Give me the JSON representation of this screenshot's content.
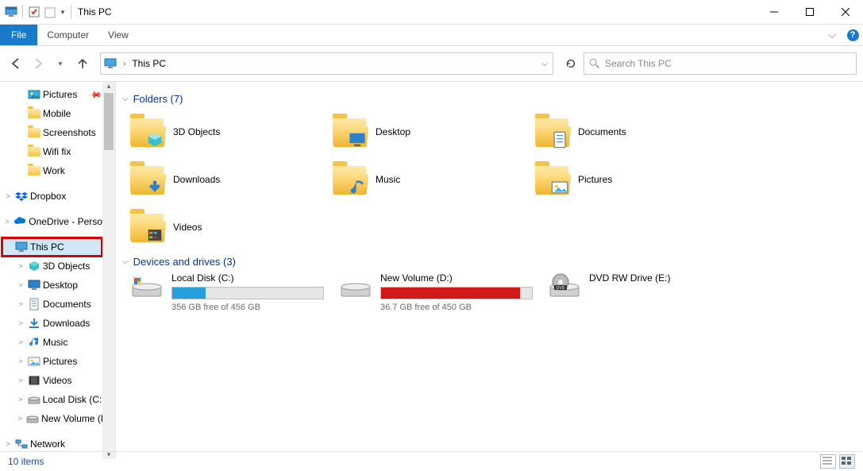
{
  "window": {
    "title": "This PC"
  },
  "ribbon": {
    "file": "File",
    "tabs": [
      "Computer",
      "View"
    ]
  },
  "nav": {
    "breadcrumb_icon": "pc",
    "breadcrumb": "This PC",
    "search_placeholder": "Search This PC"
  },
  "sidebar": {
    "items": [
      {
        "label": "Pictures",
        "icon": "pictures-lib",
        "pinned": true,
        "indent": 1
      },
      {
        "label": "Mobile",
        "icon": "folder",
        "indent": 1
      },
      {
        "label": "Screenshots",
        "icon": "folder",
        "indent": 1
      },
      {
        "label": "Wifi fix",
        "icon": "folder",
        "indent": 1
      },
      {
        "label": "Work",
        "icon": "folder",
        "indent": 1
      },
      {
        "label": "Dropbox",
        "icon": "dropbox",
        "expander": true,
        "indent": 0,
        "gapBefore": true
      },
      {
        "label": "OneDrive - Personal",
        "icon": "onedrive",
        "expander": true,
        "indent": 0,
        "gapBefore": true
      },
      {
        "label": "This PC",
        "icon": "pc",
        "indent": 0,
        "highlight": true,
        "gapBefore": true
      },
      {
        "label": "3D Objects",
        "icon": "3d",
        "expander": true,
        "indent": 1
      },
      {
        "label": "Desktop",
        "icon": "desktop",
        "expander": true,
        "indent": 1
      },
      {
        "label": "Documents",
        "icon": "documents",
        "expander": true,
        "indent": 1
      },
      {
        "label": "Downloads",
        "icon": "downloads",
        "expander": true,
        "indent": 1
      },
      {
        "label": "Music",
        "icon": "music",
        "expander": true,
        "indent": 1
      },
      {
        "label": "Pictures",
        "icon": "pictures",
        "expander": true,
        "indent": 1
      },
      {
        "label": "Videos",
        "icon": "videos",
        "expander": true,
        "indent": 1
      },
      {
        "label": "Local Disk (C:)",
        "icon": "disk",
        "expander": true,
        "indent": 1
      },
      {
        "label": "New Volume (D:)",
        "icon": "disk",
        "expander": true,
        "indent": 1
      },
      {
        "label": "Network",
        "icon": "network",
        "expander": true,
        "indent": 0,
        "gapBefore": true
      }
    ]
  },
  "sections": {
    "folders_title": "Folders (7)",
    "drives_title": "Devices and drives (3)"
  },
  "folders": [
    {
      "label": "3D Objects",
      "overlay": "3d"
    },
    {
      "label": "Desktop",
      "overlay": "desktop"
    },
    {
      "label": "Documents",
      "overlay": "documents"
    },
    {
      "label": "Downloads",
      "overlay": "downloads"
    },
    {
      "label": "Music",
      "overlay": "music"
    },
    {
      "label": "Pictures",
      "overlay": "pictures"
    },
    {
      "label": "Videos",
      "overlay": "videos"
    }
  ],
  "drives": [
    {
      "name": "Local Disk (C:)",
      "free_text": "356 GB free of 456 GB",
      "fill_pct": 22,
      "fill_color": "#26a0da",
      "icon": "localdisk"
    },
    {
      "name": "New Volume (D:)",
      "free_text": "36.7 GB free of 450 GB",
      "fill_pct": 92,
      "fill_color": "#d11919",
      "icon": "disk"
    },
    {
      "name": "DVD RW Drive (E:)",
      "free_text": "",
      "fill_pct": 0,
      "fill_color": "",
      "icon": "dvd"
    }
  ],
  "status": {
    "text": "10 items"
  }
}
